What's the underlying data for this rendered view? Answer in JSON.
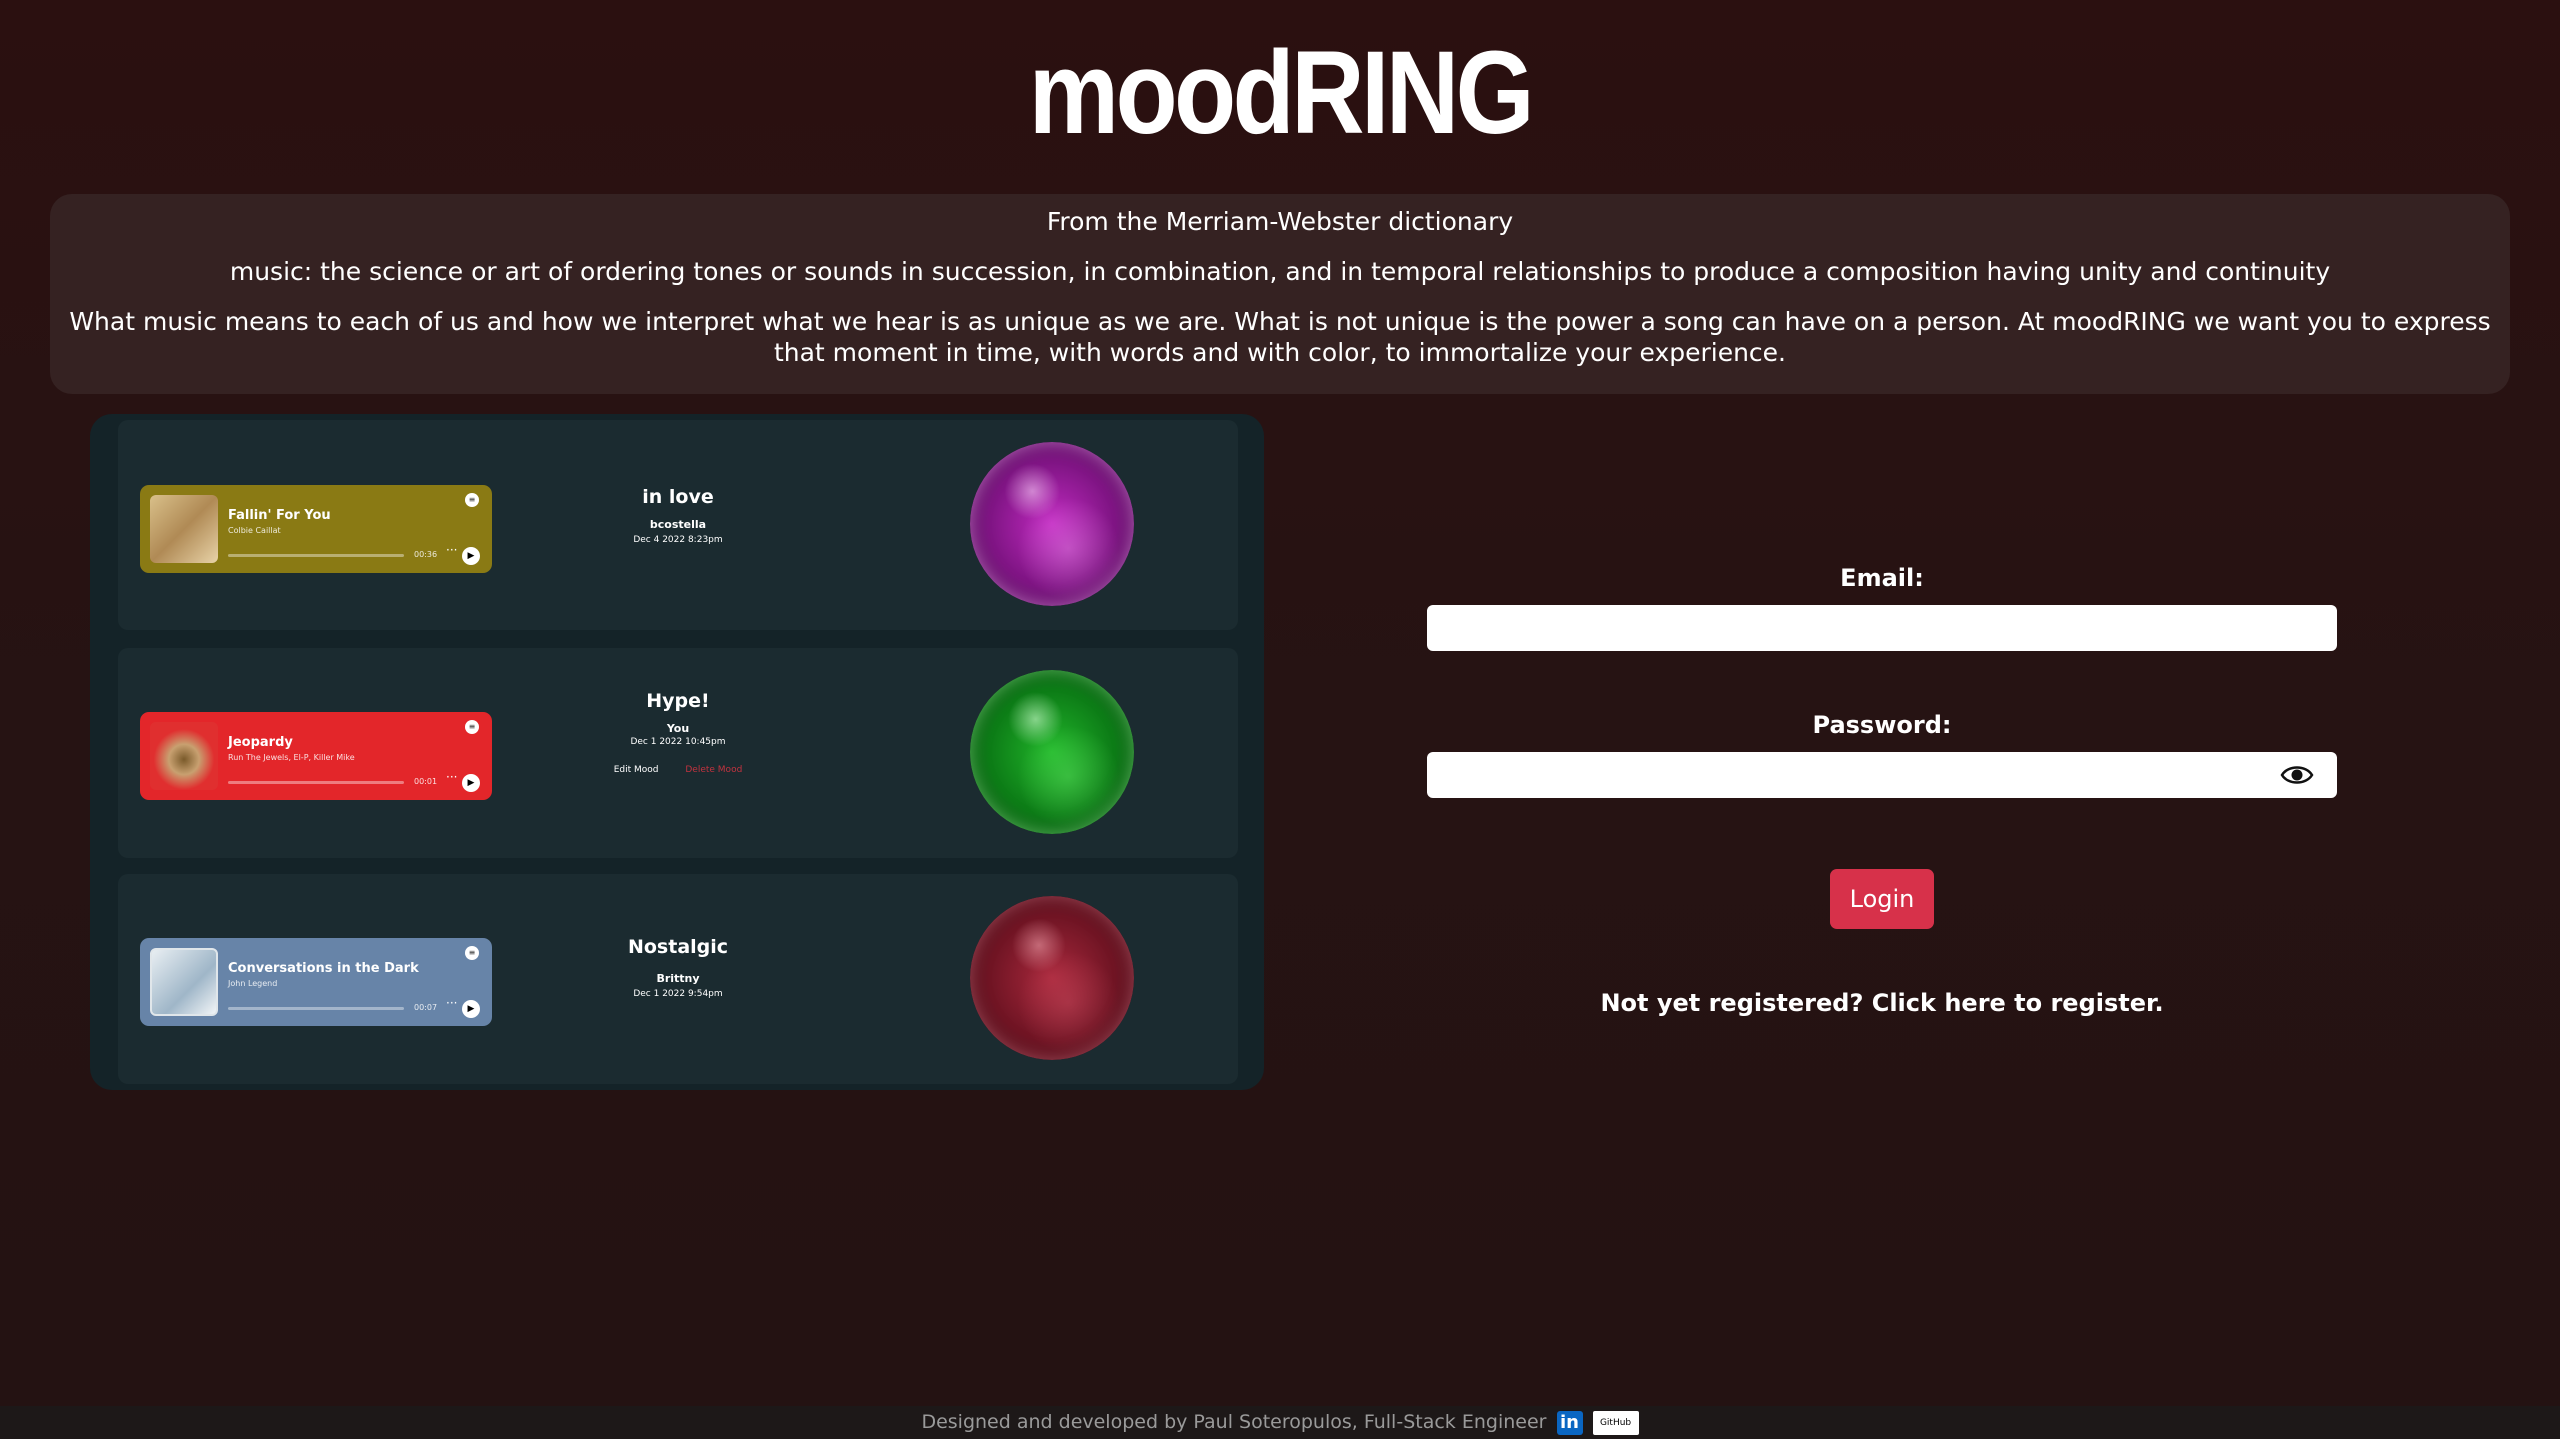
{
  "app": {
    "title": "moodRING"
  },
  "intro": {
    "line1": "From the Merriam-Webster dictionary",
    "line2": "music: the science or art of ordering tones or sounds in succession, in combination, and in temporal relationships to produce a composition having unity and continuity",
    "line3": "What music means to each of us and how we interpret what we hear is as unique as we are. What is not unique is the power a song can have on a person. At moodRING we want you to express that moment in time, with words and with color, to immortalize your experience."
  },
  "moods": [
    {
      "song": "Fallin' For You",
      "artist": "Colbie Caillat",
      "time": "00:36",
      "player_color": "#8a7a14",
      "mood": "in love",
      "user": "bcostella",
      "date": "Dec 4 2022 8:23pm",
      "orb_color": "magenta"
    },
    {
      "song": "Jeopardy",
      "artist": "Run The Jewels, El-P, Killer Mike",
      "time": "00:01",
      "player_color": "#e3262a",
      "mood": "Hype!",
      "user": "You",
      "date": "Dec 1 2022 10:45pm",
      "edit_label": "Edit Mood",
      "delete_label": "Delete Mood",
      "orb_color": "green"
    },
    {
      "song": "Conversations in the Dark",
      "artist": "John Legend",
      "time": "00:07",
      "player_color": "#6784a8",
      "mood": "Nostalgic",
      "user": "Brittny",
      "date": "Dec 1 2022 9:54pm",
      "orb_color": "crimson"
    }
  ],
  "login": {
    "email_label": "Email:",
    "email_value": "",
    "password_label": "Password:",
    "password_value": "",
    "button_label": "Login",
    "register_text": "Not yet registered? Click here to register."
  },
  "footer": {
    "text": "Designed and developed by Paul Soteropulos, Full-Stack Engineer",
    "linkedin_label": "in",
    "github_label": "GitHub"
  },
  "colors": {
    "accent": "#d7314a",
    "background": "#2a1111",
    "panel": "#142328"
  }
}
